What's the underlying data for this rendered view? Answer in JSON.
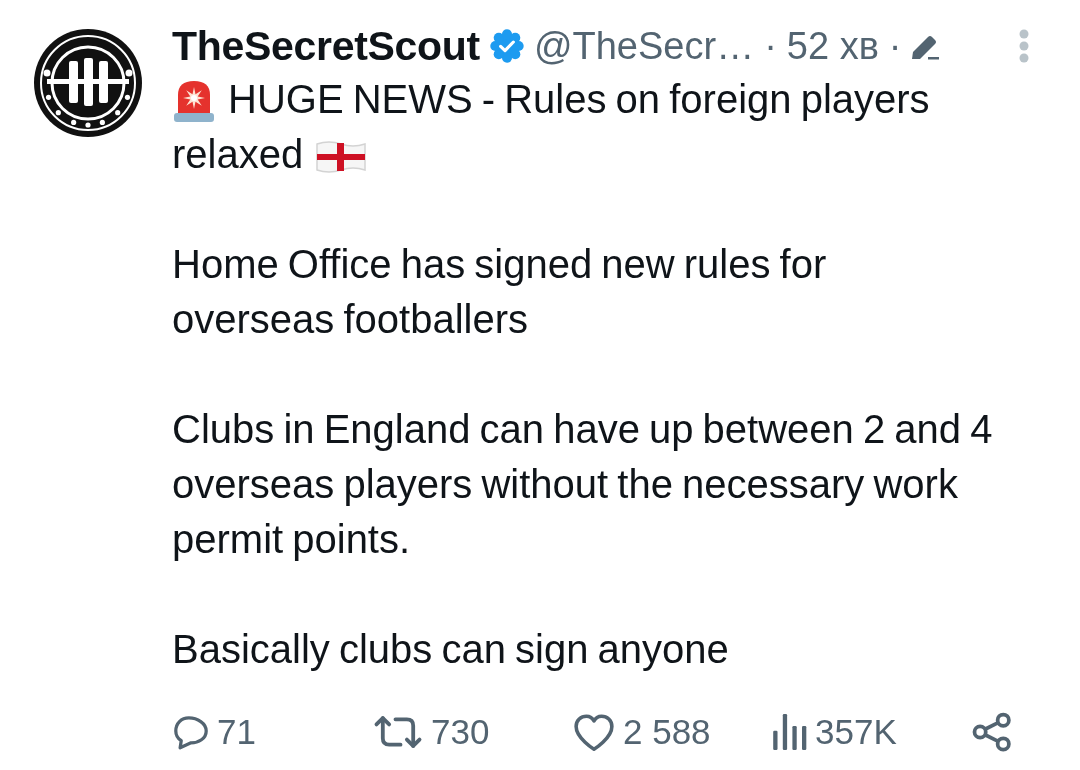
{
  "header": {
    "name": "TheSecretScout",
    "verified": true,
    "handle": "@TheSecr…",
    "time_separator": "·",
    "time": "52 хв",
    "edited_separator": "·",
    "edited": true
  },
  "paragraphs": [
    {
      "kind": "headline",
      "lines": [
        "HUGE NEWS - Rules on foreign players",
        "relaxed"
      ]
    },
    {
      "kind": "plain",
      "text": "Home Office has signed new rules for overseas footballers"
    },
    {
      "kind": "plain",
      "text": "Clubs in England can have up between 2 and 4 overseas players without the necessary work permit points."
    },
    {
      "kind": "plain",
      "text": "Basically clubs can sign anyone"
    }
  ],
  "actions": [
    {
      "kind": "reply",
      "count": "71"
    },
    {
      "kind": "repost",
      "count": "730"
    },
    {
      "kind": "like",
      "count": "2 588"
    },
    {
      "kind": "views",
      "count": "357K"
    },
    {
      "kind": "share"
    }
  ]
}
